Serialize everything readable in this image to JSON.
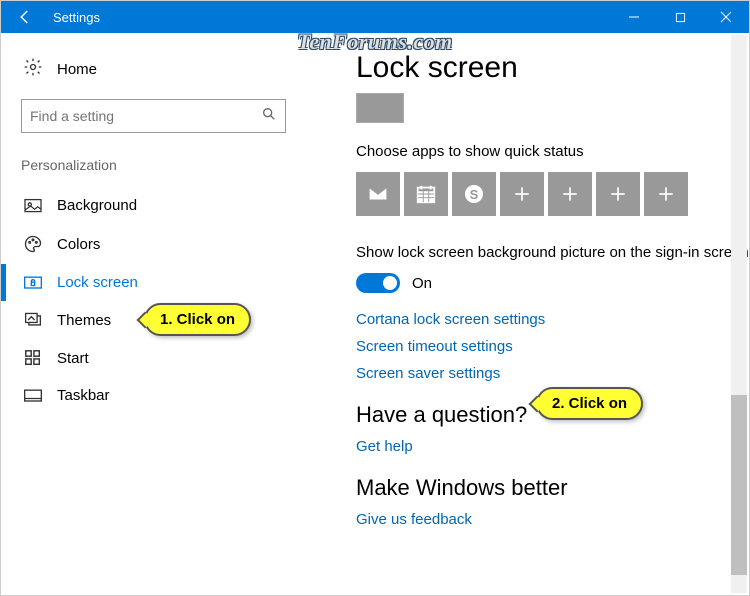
{
  "titlebar": {
    "title": "Settings"
  },
  "watermark": "TenForums.com",
  "sidebar": {
    "home": "Home",
    "search_placeholder": "Find a setting",
    "section": "Personalization",
    "items": [
      {
        "label": "Background"
      },
      {
        "label": "Colors"
      },
      {
        "label": "Lock screen"
      },
      {
        "label": "Themes"
      },
      {
        "label": "Start"
      },
      {
        "label": "Taskbar"
      }
    ]
  },
  "main": {
    "title": "Lock screen",
    "quick_status_label": "Choose apps to show quick status",
    "bg_signin_label": "Show lock screen background picture on the sign-in screen",
    "toggle_state": "On",
    "link_cortana": "Cortana lock screen settings",
    "link_timeout": "Screen timeout settings",
    "link_saver": "Screen saver settings",
    "question_heading": "Have a question?",
    "link_help": "Get help",
    "better_heading": "Make Windows better",
    "link_feedback": "Give us feedback"
  },
  "annotations": {
    "c1": "1. Click on",
    "c2": "2. Click on"
  }
}
